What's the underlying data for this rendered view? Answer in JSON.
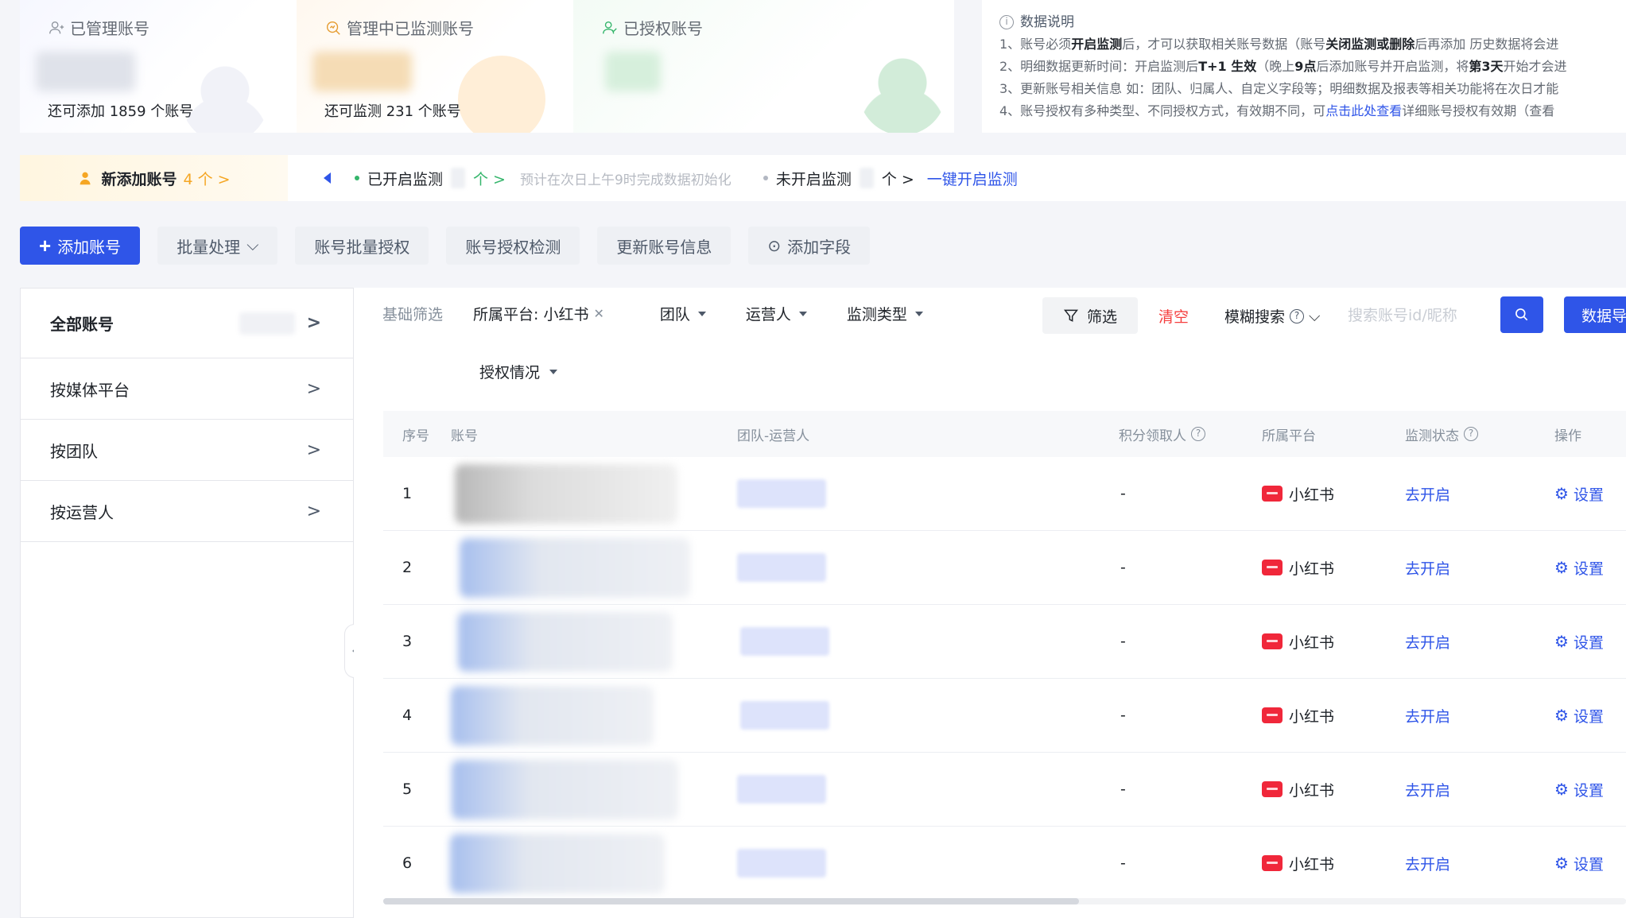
{
  "stats": [
    {
      "title": "已管理账号",
      "icon": "user-icon",
      "sub": "还可添加 1859 个账号"
    },
    {
      "title": "管理中已监测账号",
      "icon": "monitor-search-icon",
      "sub": "还可监测 231 个账号"
    },
    {
      "title": "已授权账号",
      "icon": "authorized-user-icon",
      "sub": ""
    }
  ],
  "notes": {
    "title": "数据说明",
    "lines": [
      [
        "1、账号必须",
        "开启监测",
        "后，才可以获取相关账号数据（账号",
        "关闭监测或删除",
        "后再添加 历史数据将会进"
      ],
      [
        "2、明细数据更新时间：开启监测后",
        "T+1 生效",
        "（晚上",
        "9点",
        "后添加账号并开启监测，将",
        "第3天",
        "开始才会进"
      ],
      [
        "3、更新账号相关信息 如：团队、归属人、自定义字段等；明细数据及报表等相关功能将在次日才能"
      ],
      [
        "4、账号授权有多种类型、不同授权方式，有效期不同，可",
        "点击此处查看",
        "详细账号授权有效期（查看"
      ]
    ]
  },
  "monitor_bar": {
    "new_accounts_label": "新添加账号",
    "new_accounts_count": "4 个 >",
    "enabled_label": "已开启监测",
    "enabled_suffix": "个 >",
    "hint": "预计在次日上午9时完成数据初始化",
    "disabled_label": "未开启监测",
    "disabled_suffix": "个 >",
    "one_click": "一键开启监测"
  },
  "toolbar": {
    "add": "添加账号",
    "batch": "批量处理",
    "batch_auth": "账号批量授权",
    "auth_check": "账号授权检测",
    "update_info": "更新账号信息",
    "add_field": "添加字段"
  },
  "sidebar": {
    "items": [
      {
        "label": "全部账号",
        "active": true
      },
      {
        "label": "按媒体平台",
        "active": false
      },
      {
        "label": "按团队",
        "active": false
      },
      {
        "label": "按运营人",
        "active": false
      }
    ]
  },
  "filters": {
    "basic_label": "基础筛选",
    "platform_chip": "所属平台: 小红书",
    "team": "团队",
    "operator": "运营人",
    "monitor_type": "监测类型",
    "auth_status": "授权情况",
    "screen": "筛选",
    "clear": "清空",
    "fuzzy": "模糊搜索",
    "search_placeholder": "搜索账号id/昵称",
    "data_btn": "数据导"
  },
  "table": {
    "headers": {
      "idx": "序号",
      "account": "账号",
      "team": "团队-运营人",
      "score": "积分领取人",
      "platform": "所属平台",
      "status": "监测状态",
      "op": "操作"
    },
    "rows": [
      {
        "idx": "1",
        "score": "-",
        "platform": "小红书",
        "status": "去开启",
        "op": "设置"
      },
      {
        "idx": "2",
        "score": "-",
        "platform": "小红书",
        "status": "去开启",
        "op": "设置"
      },
      {
        "idx": "3",
        "score": "-",
        "platform": "小红书",
        "status": "去开启",
        "op": "设置"
      },
      {
        "idx": "4",
        "score": "-",
        "platform": "小红书",
        "status": "去开启",
        "op": "设置"
      },
      {
        "idx": "5",
        "score": "-",
        "platform": "小红书",
        "status": "去开启",
        "op": "设置"
      },
      {
        "idx": "6",
        "score": "-",
        "platform": "小红书",
        "status": "去开启",
        "op": "设置"
      }
    ]
  },
  "colors": {
    "primary": "#2f55e8",
    "danger": "#f53f3f",
    "success": "#34b56b",
    "warning": "#f5a623",
    "xiaohongshu": "#f0273a"
  }
}
